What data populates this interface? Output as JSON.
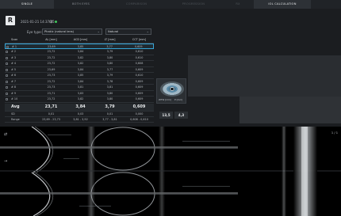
{
  "tabs": [
    {
      "label": "SINGLE",
      "state": "active"
    },
    {
      "label": "BOTH EYES",
      "state": "normal"
    },
    {
      "label": "COMPARISON",
      "state": "dim"
    },
    {
      "label": "PROGRESSION",
      "state": "dim"
    },
    {
      "label": "RX",
      "state": "dim"
    },
    {
      "label": "IOL CALCULATION",
      "state": "highlight"
    }
  ],
  "header": {
    "badge": "R",
    "datetime": "2021-01-21 14:37:05",
    "qi_label": "QI:",
    "qi_status_color": "#3fc85a"
  },
  "controls": {
    "eye_type_label": "Eye type:",
    "eye_type_value": "Phakic (natural lens)",
    "lens_value": "Natural"
  },
  "table": {
    "headers": [
      "Scan",
      "AL [mm]",
      "ACD [mm]",
      "LT [mm]",
      "CCT [mm]"
    ],
    "rows": [
      [
        "# 1",
        "23,69",
        "3,85",
        "3,77",
        "0,609"
      ],
      [
        "# 2",
        "23,72",
        "3,84",
        "3,79",
        "0,610"
      ],
      [
        "# 3",
        "23,72",
        "3,82",
        "3,80",
        "0,610"
      ],
      [
        "# 4",
        "23,72",
        "3,82",
        "3,80",
        "0,608"
      ],
      [
        "# 5",
        "23,69",
        "3,84",
        "3,77",
        "0,609"
      ],
      [
        "# 6",
        "23,73",
        "3,85",
        "3,79",
        "0,610"
      ],
      [
        "# 7",
        "23,72",
        "3,84",
        "3,78",
        "0,609"
      ],
      [
        "# 8",
        "23,73",
        "3,81",
        "3,81",
        "0,609"
      ],
      [
        "# 9",
        "23,71",
        "3,83",
        "3,80",
        "0,609"
      ],
      [
        "# 10",
        "23,72",
        "3,82",
        "3,80",
        "0,609"
      ]
    ],
    "avg": [
      "Avg",
      "23,71",
      "3,84",
      "3,79",
      "0,609"
    ],
    "sd": [
      "SD",
      "0,01",
      "0,03",
      "0,01",
      "0,000"
    ],
    "range": [
      "Range",
      "23,69 - 23,73",
      "3,81 - 3,92",
      "3,77 - 3,81",
      "0,608 - 0,610"
    ]
  },
  "thumbnail": {
    "label_left": "WTW [mm]",
    "label_right": "P [mm]"
  },
  "values": {
    "wtw": "13,5",
    "p": "4,3"
  },
  "scan": {
    "page_indicator": "1 / 1"
  }
}
